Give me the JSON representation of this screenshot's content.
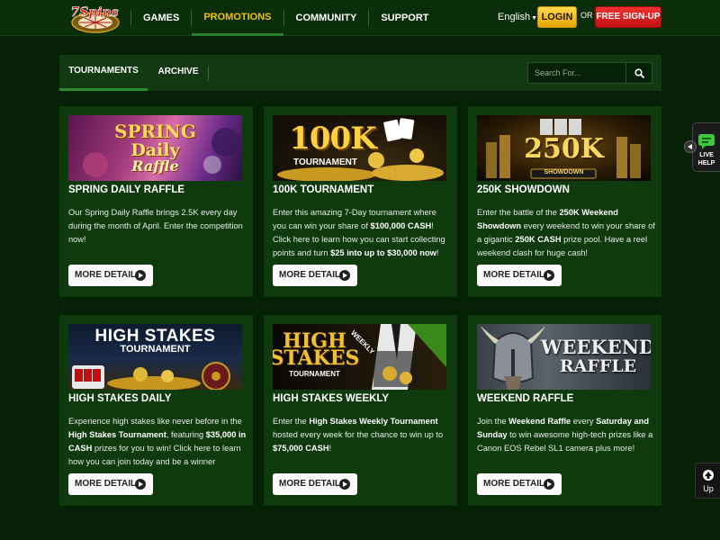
{
  "header": {
    "logo_text": "7Spins",
    "nav": [
      {
        "label": "GAMES"
      },
      {
        "label": "PROMOTIONS"
      },
      {
        "label": "COMMUNITY"
      },
      {
        "label": "SUPPORT"
      }
    ],
    "active_nav": "PROMOTIONS",
    "language": "English",
    "login_label": "LOGIN",
    "or_label": "OR",
    "signup_label": "FREE SIGN-UP"
  },
  "tabs": [
    {
      "label": "TOURNAMENTS",
      "active": true
    },
    {
      "label": "ARCHIVE",
      "active": false
    }
  ],
  "search": {
    "placeholder": "Search For..."
  },
  "cards": [
    {
      "title": "SPRING DAILY RAFFLE",
      "image_text": [
        "SPRING",
        "Daily",
        "Raffle"
      ],
      "desc": [
        {
          "t": "Our Spring Daily Raffle brings 2.5K every day during the month of April. Enter the competition now!"
        }
      ],
      "button": "MORE DETAILS"
    },
    {
      "title": "100K TOURNAMENT",
      "image_text": [
        "100K",
        "TOURNAMENT"
      ],
      "desc": [
        {
          "t": "Enter this amazing 7-Day tournament where you can win your share of "
        },
        {
          "t": "$100,000 CASH",
          "b": true
        },
        {
          "t": "! Click here to learn how you can start collecting points and turn "
        },
        {
          "t": "$25 into up to $30,000 now",
          "b": true
        },
        {
          "t": "!"
        }
      ],
      "button": "MORE DETAILS"
    },
    {
      "title": "250K SHOWDOWN",
      "image_text": [
        "250K",
        "SHOWDOWN"
      ],
      "desc": [
        {
          "t": "Enter the battle of the "
        },
        {
          "t": "250K Weekend Showdown",
          "b": true
        },
        {
          "t": " every weekend to win your share of a gigantic "
        },
        {
          "t": "250K CASH",
          "b": true
        },
        {
          "t": " prize pool. Have a reel weekend clash for huge cash!"
        }
      ],
      "button": "MORE DETAILS"
    },
    {
      "title": "HIGH STAKES DAILY",
      "image_text": [
        "HIGH STAKES",
        "TOURNAMENT"
      ],
      "desc": [
        {
          "t": "Experience high stakes like never before in the "
        },
        {
          "t": "High Stakes Tournament",
          "b": true
        },
        {
          "t": ", featuring "
        },
        {
          "t": "$35,000 in CASH",
          "b": true
        },
        {
          "t": " prizes for you to win! Click here to learn how you can join today and be a winner"
        }
      ],
      "button": "MORE DETAILS"
    },
    {
      "title": "HIGH STAKES WEEKLY",
      "image_text": [
        "HIGH",
        "STAKES",
        "TOURNAMENT",
        "WEEKLY"
      ],
      "desc": [
        {
          "t": "Enter the "
        },
        {
          "t": "High Stakes Weekly Tournament",
          "b": true
        },
        {
          "t": " hosted every week for the chance to win up to "
        },
        {
          "t": "$75,000 CASH",
          "b": true
        },
        {
          "t": "!"
        }
      ],
      "button": "MORE DETAILS"
    },
    {
      "title": "WEEKEND RAFFLE",
      "image_text": [
        "WEEKEND",
        "RAFFLE"
      ],
      "desc": [
        {
          "t": "Join the "
        },
        {
          "t": "Weekend Raffle",
          "b": true
        },
        {
          "t": " every "
        },
        {
          "t": "Saturday and Sunday",
          "b": true
        },
        {
          "t": " to win awesome high-tech prizes like a Canon EOS Rebel SL1 camera plus more!"
        }
      ],
      "button": "MORE DETAILS"
    }
  ],
  "widgets": {
    "live_help": "LIVE HELP",
    "up": "Up"
  },
  "colors": {
    "background": "#062106",
    "card": "#0e3a0e",
    "active_nav": "#f2c200",
    "login": "#f5c000",
    "signup": "#d81818"
  }
}
